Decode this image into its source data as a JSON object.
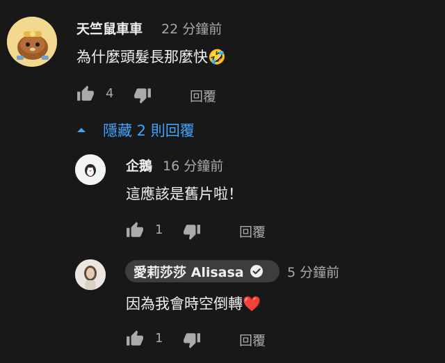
{
  "comment": {
    "author": "天竺鼠車車",
    "time": "22 分鐘前",
    "text": "為什麼頭髮長那麼快",
    "emoji": "🤣",
    "likes": "4",
    "reply_label": "回覆",
    "toggle_label": "隱藏 2 則回覆"
  },
  "replies": [
    {
      "author": "企鵝",
      "time": "16 分鐘前",
      "text": "這應該是舊片啦！",
      "likes": "1",
      "reply_label": "回覆"
    },
    {
      "author": "愛莉莎莎 Alisasa",
      "verified": true,
      "time": "5 分鐘前",
      "text": "因為我會時空倒轉",
      "emoji": "❤️",
      "likes": "1",
      "reply_label": "回覆"
    }
  ],
  "colors": {
    "background": "#181818",
    "link_blue": "#3ea6ff",
    "muted": "#aaaaaa",
    "badge_bg": "#3d3d3d"
  },
  "icons": [
    "thumbs-up-icon",
    "thumbs-down-icon",
    "caret-up-icon",
    "verified-check-icon"
  ]
}
